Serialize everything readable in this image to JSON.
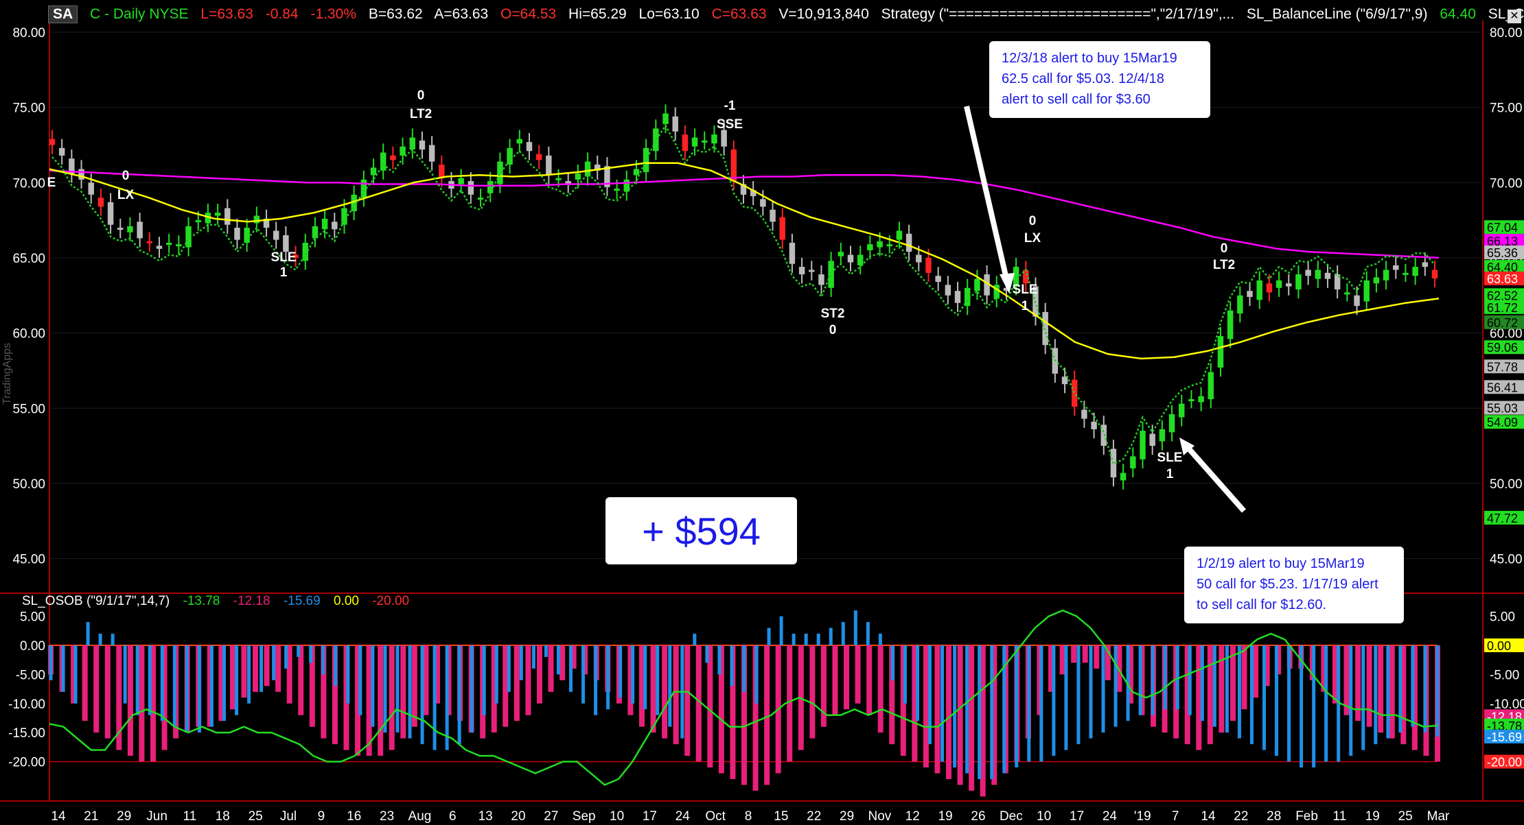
{
  "header": {
    "symbol_box": "SA",
    "title": "C - Daily  NYSE",
    "last": "L=63.63",
    "change": "-0.84",
    "change_pct": "-1.30%",
    "bid": "B=63.62",
    "ask": "A=63.63",
    "open": "O=64.53",
    "high": "Hi=65.29",
    "low": "Lo=63.10",
    "close": "C=63.63",
    "volume": "V=10,913,840",
    "strategy": "Strategy (\"========================\",\"2/17/19\",...",
    "balance_line": "SL_BalanceLine (\"6/9/17\",9)",
    "balance_value": "64.40",
    "calc": "SL_Calc ( ...",
    "colors": {
      "green": "#22dd22",
      "red": "#ff3030",
      "white": "#ffffff",
      "yellow": "#ffff00"
    }
  },
  "side_label": "TradingApps",
  "notes": {
    "note1": [
      "12/3/18 alert to buy 15Mar19",
      "62.5 call for $5.03. 12/4/18",
      "alert to sell call for $3.60"
    ],
    "note2": [
      "1/2/19 alert to buy 15Mar19",
      "50 call for $5.23. 1/17/19 alert",
      "to sell call for $12.60."
    ],
    "profit": "+ $594"
  },
  "subpanel": {
    "title": "SL_OSOB (\"9/1/17\",14,7)",
    "v1": "-13.78",
    "v2": "-12.18",
    "v3": "-15.69",
    "v4": "0.00",
    "v5": "-20.00"
  },
  "chart_data": [
    {
      "type": "candlestick",
      "title": "C - Daily NYSE",
      "ylim": [
        42,
        81
      ],
      "y_ticks": [
        "80.00",
        "75.00",
        "70.00",
        "65.00",
        "60.00",
        "55.00",
        "50.00",
        "45.00"
      ],
      "x_ticks": [
        "14",
        "21",
        "29",
        "Jun",
        "11",
        "18",
        "25",
        "Jul",
        "9",
        "16",
        "23",
        "Aug",
        "6",
        "13",
        "20",
        "27",
        "Sep",
        "10",
        "17",
        "24",
        "Oct",
        "8",
        "15",
        "22",
        "29",
        "Nov",
        "12",
        "19",
        "26",
        "Dec",
        "10",
        "17",
        "24",
        "'19",
        "7",
        "14",
        "22",
        "28",
        "Feb",
        "11",
        "19",
        "25",
        "Mar"
      ],
      "approx_closes": [
        72.5,
        71.8,
        70.6,
        70.2,
        69.2,
        68.4,
        67.2,
        66.9,
        67.1,
        66.3,
        66.0,
        65.6,
        66.0,
        65.9,
        67.1,
        67.5,
        68.0,
        68.0,
        67.2,
        66.2,
        67.0,
        67.8,
        67.0,
        66.2,
        65.4,
        65.0,
        66.0,
        67.1,
        67.6,
        66.9,
        68.3,
        69.2,
        70.2,
        71.0,
        72.0,
        71.5,
        72.4,
        73.0,
        72.2,
        71.4,
        70.3,
        69.6,
        70.3,
        69.2,
        69.0,
        70.1,
        71.4,
        72.3,
        72.9,
        72.1,
        71.5,
        70.5,
        70.3,
        69.9,
        70.6,
        71.4,
        70.8,
        69.7,
        69.6,
        70.2,
        70.9,
        72.3,
        73.6,
        74.6,
        73.4,
        72.1,
        73.0,
        72.8,
        73.2,
        72.4,
        70.1,
        69.2,
        69.1,
        68.4,
        67.4,
        66.2,
        64.6,
        63.9,
        64.1,
        63.2,
        64.8,
        65.4,
        64.7,
        65.2,
        65.9,
        66.1,
        65.9,
        66.8,
        65.4,
        64.7,
        64.0,
        63.4,
        62.5,
        62.0,
        63.0,
        63.6,
        62.5,
        63.2,
        62.8,
        64.4,
        63.3,
        61.1,
        59.2,
        57.3,
        56.6,
        55.1,
        54.3,
        53.6,
        52.5,
        50.4,
        50.7,
        51.8,
        53.5,
        52.5,
        53.6,
        54.6,
        55.3,
        55.6,
        55.8,
        57.4,
        59.8,
        61.5,
        62.5,
        62.4,
        63.5,
        62.7,
        63.5,
        63.1,
        63.9,
        63.8,
        64.2,
        63.6,
        62.9,
        62.7,
        61.8,
        63.5,
        63.7,
        64.2,
        64.2,
        64.0,
        64.4,
        64.4,
        63.63
      ],
      "series": [
        {
          "name": "",
          "color": "#ff00ff",
          "values": [
            70.8,
            70.7,
            70.6,
            70.5,
            70.4,
            70.3,
            70.2,
            70.1,
            70.0,
            70.0,
            69.9,
            69.9,
            69.9,
            69.8,
            69.8,
            69.8,
            69.9,
            69.9,
            70.0,
            70.1,
            70.2,
            70.3,
            70.4,
            70.4,
            70.5,
            70.5,
            70.5,
            70.4,
            70.2,
            69.9,
            69.5,
            69.0,
            68.5,
            68.0,
            67.5,
            67.0,
            66.4,
            66.0,
            65.6,
            65.4,
            65.3,
            65.2,
            65.1,
            65.0
          ]
        },
        {
          "name": "",
          "color": "#ffff00",
          "values": [
            70.9,
            70.4,
            69.7,
            69.0,
            68.2,
            67.6,
            67.4,
            67.6,
            68.0,
            68.6,
            69.3,
            70.0,
            70.4,
            70.5,
            70.4,
            70.5,
            70.7,
            71.0,
            71.3,
            71.3,
            70.8,
            69.8,
            68.6,
            67.7,
            67.1,
            66.5,
            65.8,
            64.9,
            63.8,
            62.4,
            60.9,
            59.4,
            58.6,
            58.3,
            58.4,
            58.8,
            59.4,
            60.1,
            60.7,
            61.2,
            61.6,
            62.0,
            62.3
          ]
        },
        {
          "name": "",
          "color": "#22cc22",
          "style": "dotted"
        }
      ],
      "annotations": [
        "E",
        "0",
        "LX",
        "SLE",
        "1",
        "0",
        "LT2",
        "-1",
        "SSE",
        "ST2",
        "0",
        "0",
        "LX",
        "SLE",
        "1",
        "SLE",
        "1",
        "0",
        "LT2"
      ],
      "right_labels": [
        {
          "v": 67.04,
          "t": "67.04",
          "bg": "#22dd22",
          "fg": "#000"
        },
        {
          "v": 66.13,
          "t": "66.13",
          "bg": "#ff00ff",
          "fg": "#000"
        },
        {
          "v": 65.36,
          "t": "65.36",
          "bg": "#c0c0c0",
          "fg": "#000"
        },
        {
          "v": 64.4,
          "t": "64.40",
          "bg": "#22dd22",
          "fg": "#000"
        },
        {
          "v": 63.63,
          "t": "63.63",
          "bg": "#ff2222",
          "fg": "#fff"
        },
        {
          "v": 62.52,
          "t": "62.52",
          "bg": "#22dd22",
          "fg": "#000"
        },
        {
          "v": 61.72,
          "t": "61.72",
          "bg": "#22dd22",
          "fg": "#000"
        },
        {
          "v": 60.72,
          "t": "60.72",
          "bg": "#228822",
          "fg": "#000"
        },
        {
          "v": 59.06,
          "t": "59.06",
          "bg": "#22dd22",
          "fg": "#000"
        },
        {
          "v": 57.78,
          "t": "57.78",
          "bg": "#bbbbbb",
          "fg": "#000"
        },
        {
          "v": 56.41,
          "t": "56.41",
          "bg": "#bbbbbb",
          "fg": "#000"
        },
        {
          "v": 55.03,
          "t": "55.03",
          "bg": "#bbbbbb",
          "fg": "#000"
        },
        {
          "v": 54.09,
          "t": "54.09",
          "bg": "#22dd22",
          "fg": "#000"
        },
        {
          "v": 47.72,
          "t": "47.72",
          "bg": "#22dd22",
          "fg": "#000"
        }
      ]
    },
    {
      "type": "bar",
      "title": "SL_OSOB (\"9/1/17\",14,7)",
      "ylim": [
        -27,
        9
      ],
      "y_ticks": [
        "5.00",
        "0.00",
        "-5.00",
        "-10.00",
        "-15.00",
        "-20.00"
      ],
      "series": [
        {
          "name": "",
          "color": "#e8207a",
          "values": [
            -5,
            -8,
            -10,
            -13,
            -15,
            -16,
            -18,
            -19,
            -20,
            -20,
            -18,
            -16,
            -15,
            -14,
            -14,
            -13,
            -11,
            -9,
            -8,
            -7,
            -8,
            -10,
            -12,
            -14,
            -16,
            -17,
            -18,
            -19,
            -19,
            -19,
            -18,
            -16,
            -14,
            -12,
            -10,
            -12,
            -13,
            -15,
            -16,
            -15,
            -14,
            -13,
            -12,
            -10,
            -8,
            -6,
            -4,
            -5,
            -6,
            -8,
            -10,
            -12,
            -14,
            -15,
            -16,
            -17,
            -19,
            -20,
            -21,
            -22,
            -23,
            -24,
            -25,
            -24,
            -22,
            -20,
            -18,
            -16,
            -14,
            -12,
            -11,
            -10,
            -12,
            -15,
            -17,
            -19,
            -20,
            -21,
            -22,
            -23,
            -24,
            -25,
            -26,
            -24,
            -22,
            -20,
            -16,
            -12,
            -8,
            -5,
            -3,
            -3,
            -4,
            -6,
            -8,
            -10,
            -12,
            -14,
            -15,
            -16,
            -17,
            -18,
            -17,
            -15,
            -13,
            -11,
            -9,
            -7,
            -5,
            -4,
            -4,
            -6,
            -8,
            -10,
            -12,
            -13,
            -14,
            -15,
            -16,
            -17,
            -18,
            -19,
            -20
          ]
        },
        {
          "name": "",
          "color": "#1e8fe8",
          "values": [
            -6,
            -8,
            -10,
            4,
            2,
            2,
            -10,
            -12,
            -12,
            -13,
            -14,
            -15,
            -15,
            -14,
            -13,
            -12,
            -10,
            -8,
            -6,
            -4,
            -2,
            -3,
            -5,
            -7,
            -10,
            -12,
            -14,
            -15,
            -15,
            -16,
            -17,
            -18,
            -18,
            -17,
            -15,
            -12,
            -10,
            -8,
            -6,
            -4,
            -2,
            -5,
            -8,
            -10,
            -12,
            -11,
            -9,
            -10,
            -11,
            -12,
            -14,
            -16,
            2,
            -3,
            -5,
            -7,
            -8,
            -10,
            3,
            5,
            2,
            2,
            2,
            3,
            4,
            6,
            4,
            2,
            -6,
            -10,
            -13,
            -17,
            -20,
            -21,
            -22,
            -23,
            -23,
            -22,
            -21,
            -20,
            -20,
            -19,
            -18,
            -17,
            -16,
            -15,
            -14,
            -13,
            -12,
            -12,
            -11,
            -11,
            -12,
            -13,
            -14,
            -15,
            -16,
            -17,
            -18,
            -19,
            -20,
            -21,
            -21,
            -20,
            -20,
            -19,
            -18,
            -17,
            -16,
            -15,
            -14,
            -15,
            -15.69
          ]
        },
        {
          "name": "",
          "color": "#22dd22",
          "values": [
            -13.5,
            -14,
            -16,
            -18,
            -18,
            -15,
            -12,
            -11,
            -12,
            -14,
            -15,
            -14,
            -15,
            -15,
            -14,
            -15,
            -15,
            -16,
            -17,
            -19,
            -20,
            -20,
            -19,
            -17,
            -14,
            -11,
            -12,
            -13,
            -15,
            -16,
            -18,
            -19,
            -19,
            -20,
            -21,
            -22,
            -21,
            -20,
            -20,
            -22,
            -24,
            -23,
            -20,
            -16,
            -12,
            -8,
            -8,
            -10,
            -12,
            -14,
            -14,
            -13,
            -12,
            -10,
            -9,
            -10,
            -12,
            -12,
            -11,
            -12,
            -11,
            -12,
            -13,
            -14,
            -14,
            -12,
            -10,
            -8,
            -6,
            -3,
            0,
            3,
            5,
            6,
            5,
            3,
            0,
            -4,
            -8,
            -9,
            -8,
            -6,
            -5,
            -4,
            -3,
            -2,
            -1,
            1,
            2,
            1,
            -2,
            -5,
            -8,
            -10,
            -11,
            -11,
            -12,
            -12,
            -13,
            -14,
            -13.78
          ]
        }
      ],
      "right_labels": [
        {
          "v": 0,
          "t": "0.00",
          "bg": "#ffff00",
          "fg": "#000"
        },
        {
          "v": -12.18,
          "t": "-12.18",
          "bg": "#e8207a",
          "fg": "#fff"
        },
        {
          "v": -13.78,
          "t": "-13.78",
          "bg": "#22dd22",
          "fg": "#000"
        },
        {
          "v": -15.69,
          "t": "-15.69",
          "bg": "#1e8fe8",
          "fg": "#fff"
        },
        {
          "v": -20,
          "t": "-20.00",
          "bg": "#ff2222",
          "fg": "#fff"
        }
      ]
    }
  ]
}
